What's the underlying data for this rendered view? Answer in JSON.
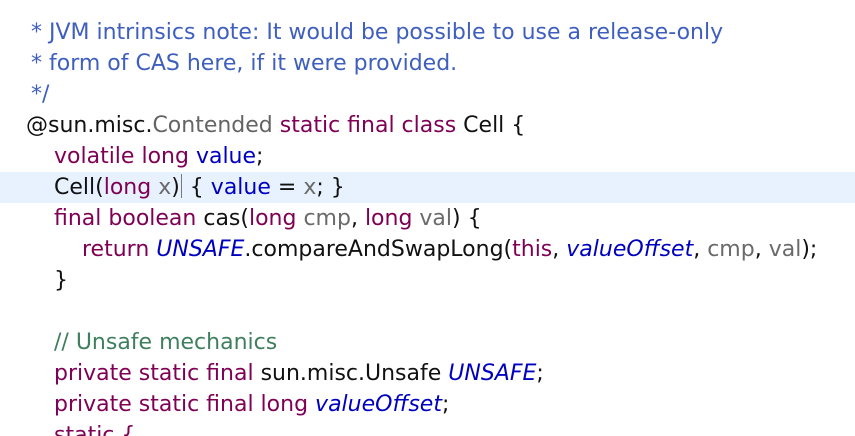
{
  "editor": {
    "line_0": {
      "doc_comment": "*"
    },
    "line_1": {
      "doc_comment": " * JVM intrinsics note: It would be possible to use a release-only"
    },
    "line_2": {
      "doc_comment": " * form of CAS here, if it were provided."
    },
    "line_3": {
      "doc_comment": " */"
    },
    "line_4": {
      "annotation_at": "@",
      "annotation_pkg": "sun.misc.",
      "annotation_name": "Contended",
      "keywords": " static final class ",
      "class_name": "Cell {"
    },
    "line_5": {
      "keywords": "volatile long ",
      "field": "value",
      "end": ";"
    },
    "line_6": {
      "name": "Cell(",
      "keyword": "long",
      "param": " x",
      "paren": ")",
      "brace_open": " {",
      "field": " value",
      "assign": " = ",
      "param2": "x",
      "end": "; }"
    },
    "line_7": {
      "keywords": "final boolean ",
      "method": "cas(",
      "kw1": "long",
      "p1": " cmp",
      "comma": ", ",
      "kw2": "long",
      "p2": " val",
      "end": ") {"
    },
    "line_8": {
      "keyword": "return ",
      "static1": "UNSAFE",
      "call": ".compareAndSwapLong(",
      "kw_this": "this",
      "comma1": ", ",
      "static2": "valueOffset",
      "comma2": ", ",
      "arg3": "cmp",
      "comma3": ", ",
      "arg4": "val",
      "end": ");"
    },
    "line_9": {
      "brace": "}"
    },
    "line_11": {
      "comment": "// Unsafe mechanics"
    },
    "line_12": {
      "keywords": "private static final ",
      "type": "sun.misc.Unsafe ",
      "static_field": "UNSAFE",
      "end": ";"
    },
    "line_13": {
      "keywords": "private static final long ",
      "static_field": "valueOffset",
      "end": ";"
    },
    "line_14": {
      "keywords": "static {"
    }
  },
  "colors": {
    "keyword": "#7f0055",
    "doc_comment": "#3f5fbf",
    "comment": "#3f7f5f",
    "field": "#0000c0",
    "annotation": "#646464",
    "current_line": "#e8f2fe"
  }
}
